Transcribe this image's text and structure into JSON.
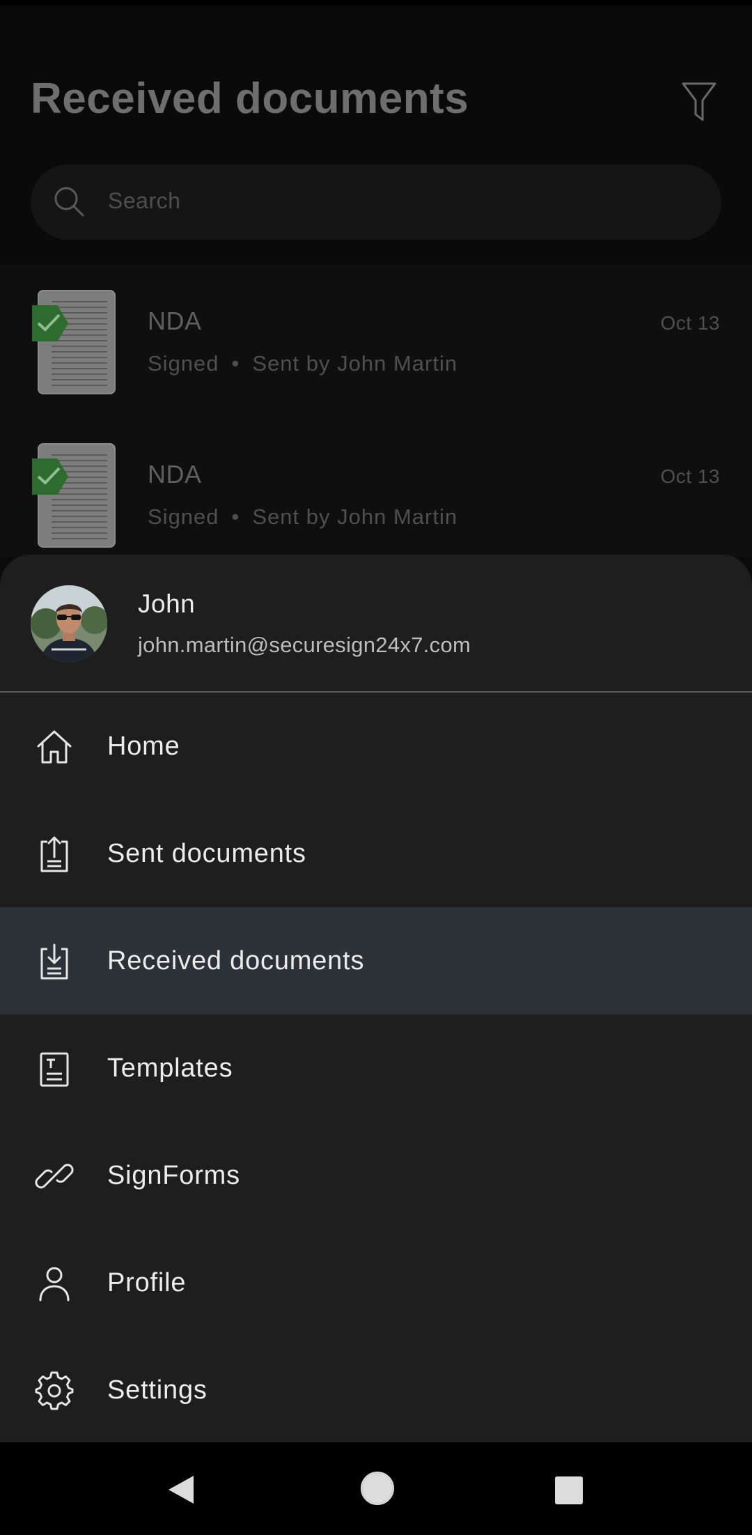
{
  "page": {
    "title": "Received documents",
    "search": {
      "placeholder": "Search"
    }
  },
  "documents": [
    {
      "title": "NDA",
      "status": "Signed",
      "separator": "•",
      "sender": "Sent by John Martin",
      "date": "Oct 13"
    },
    {
      "title": "NDA",
      "status": "Signed",
      "separator": "•",
      "sender": "Sent by John Martin",
      "date": "Oct 13"
    }
  ],
  "drawer": {
    "user": {
      "name": "John",
      "email": "john.martin@securesign24x7.com"
    },
    "items": [
      {
        "label": "Home",
        "icon": "home-icon"
      },
      {
        "label": "Sent documents",
        "icon": "upload-document-icon"
      },
      {
        "label": "Received documents",
        "icon": "download-document-icon",
        "active": true
      },
      {
        "label": "Templates",
        "icon": "template-icon"
      },
      {
        "label": "SignForms",
        "icon": "link-icon"
      },
      {
        "label": "Profile",
        "icon": "person-icon"
      },
      {
        "label": "Settings",
        "icon": "gear-icon"
      }
    ]
  },
  "colors": {
    "drawer_bg": "#1e1e1f",
    "active_item_bg": "#2d3238",
    "signed_badge": "#2e6b2f"
  }
}
